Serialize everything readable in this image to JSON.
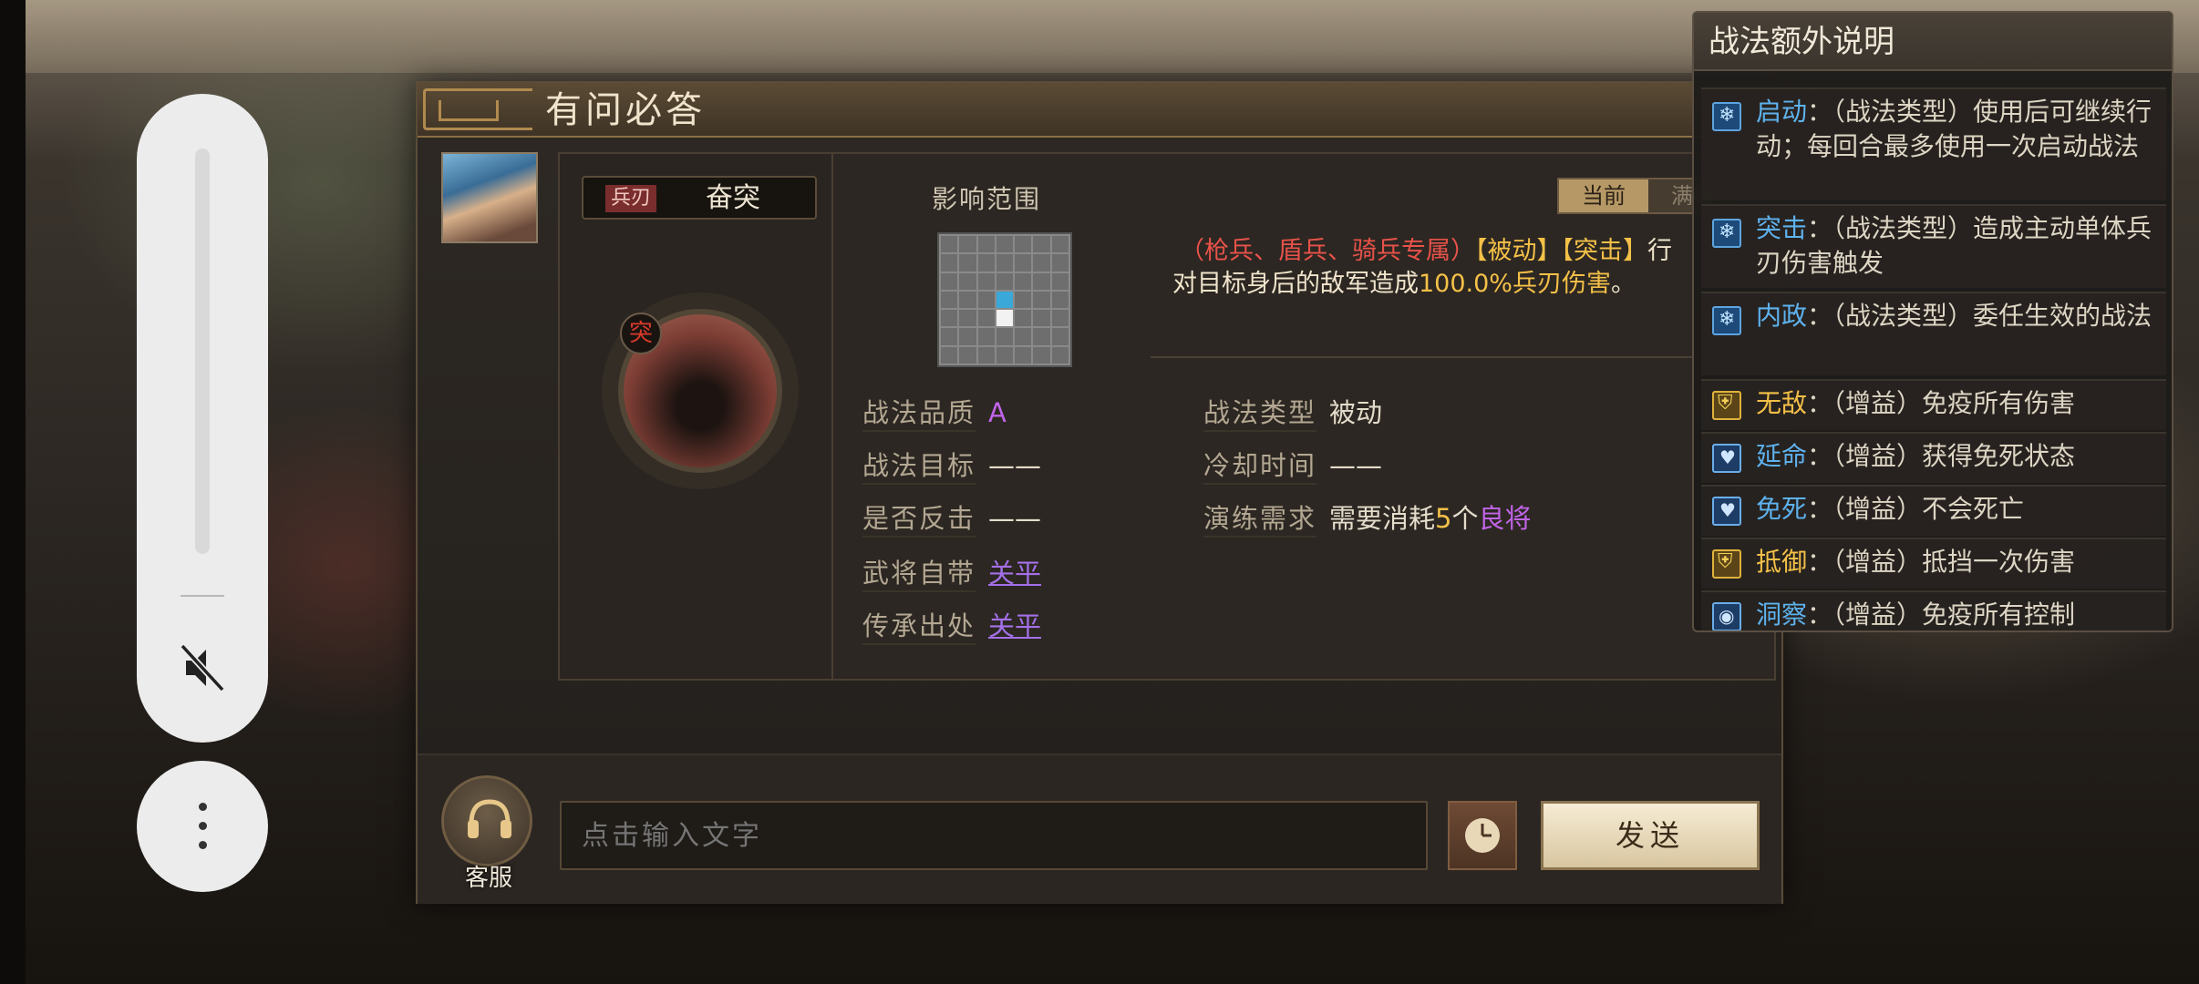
{
  "dialog": {
    "title": "有问必答",
    "skill": {
      "type_tag": "兵刃",
      "name": "奋突",
      "emblem_char": "突"
    },
    "range_label": "影响范围",
    "tabs": [
      {
        "label": "当前",
        "active": true
      },
      {
        "label": "满级",
        "active": false
      }
    ],
    "description": {
      "line1_red": "（枪兵、盾兵、骑兵专属）",
      "line1_gold1": "【被动】【突击】",
      "line1_rest": "行",
      "line2_pre": "对目标身后的敌军造成",
      "line2_gold": "100.0%兵刃伤害",
      "line2_post": "。"
    },
    "stats_left": [
      {
        "label": "战法品质",
        "value": "A",
        "style": "purple"
      },
      {
        "label": "战法目标",
        "value": "——",
        "style": "plain"
      },
      {
        "label": "是否反击",
        "value": "——",
        "style": "plain"
      },
      {
        "label": "武将自带",
        "value": "关平",
        "style": "link"
      },
      {
        "label": "传承出处",
        "value": "关平",
        "style": "link"
      }
    ],
    "stats_right": [
      {
        "label": "战法类型",
        "value": "被动"
      },
      {
        "label": "冷却时间",
        "value": "——"
      }
    ],
    "training": {
      "label": "演练需求",
      "pre": "需要消耗",
      "count": "5",
      "mid": "个",
      "quality": "良将"
    },
    "input_placeholder": "点击输入文字",
    "customer_service_label": "客服",
    "send_label": "发送"
  },
  "tooltip": {
    "title": "战法额外说明",
    "items": [
      {
        "icon": "snowflake-icon",
        "name": "启动",
        "name_color": "blue",
        "text": "：（战法类型）使用后可继续行动；每回合最多使用一次启动战法"
      },
      {
        "icon": "snowflake-icon",
        "name": "突击",
        "name_color": "blue",
        "text": "：（战法类型）造成主动单体兵刃伤害触发"
      },
      {
        "icon": "snowflake-icon",
        "name": "内政",
        "name_color": "blue",
        "text": "：（战法类型）委任生效的战法"
      },
      {
        "icon": "gold-shield-icon",
        "name": "无敌",
        "name_color": "gold",
        "text": "：（增益）免疫所有伤害"
      },
      {
        "icon": "blue-shield-icon",
        "name": "延命",
        "name_color": "blue",
        "text": "：（增益）获得免死状态"
      },
      {
        "icon": "blue-shield-icon",
        "name": "免死",
        "name_color": "blue",
        "text": "：（增益）不会死亡"
      },
      {
        "icon": "gold-shield-icon",
        "name": "抵御",
        "name_color": "gold",
        "text": "：（增益）抵挡一次伤害"
      },
      {
        "icon": "eye-icon",
        "name": "洞察",
        "name_color": "blue",
        "text": "：（增益）免疫所有控制"
      }
    ]
  }
}
